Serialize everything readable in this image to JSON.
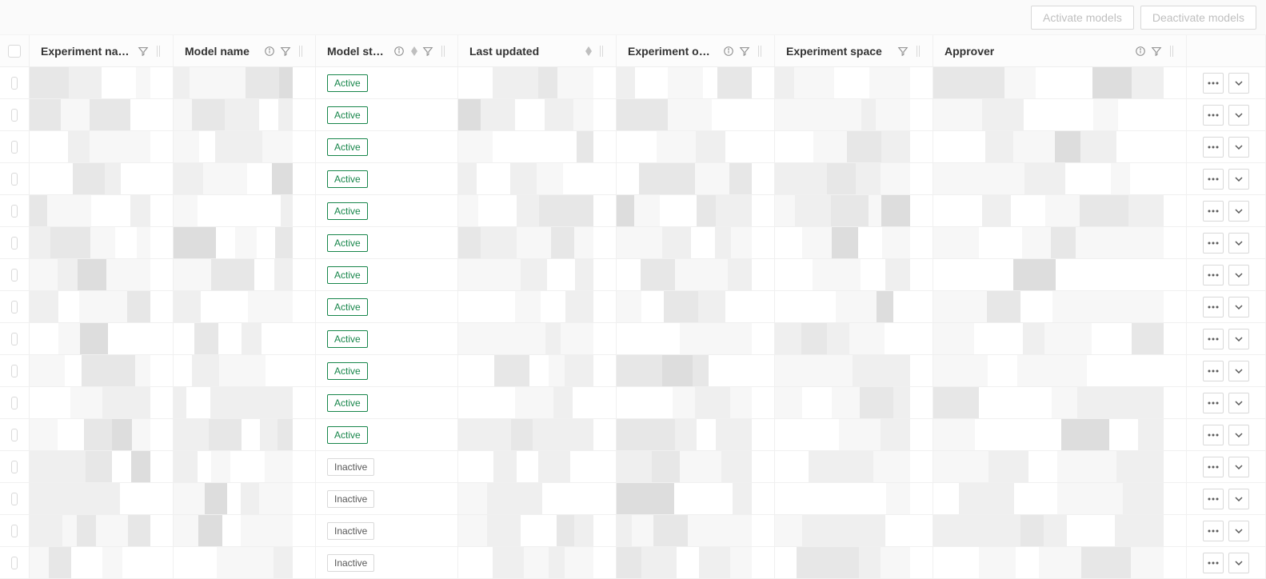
{
  "toolbar": {
    "activate_label": "Activate models",
    "deactivate_label": "Deactivate models"
  },
  "columns": {
    "experiment_name": "Experiment name",
    "model_name": "Model name",
    "model_status": "Model status",
    "last_updated": "Last updated",
    "experiment_owner": "Experiment owner",
    "experiment_space": "Experiment space",
    "approver": "Approver"
  },
  "status": {
    "active": "Active",
    "inactive": "Inactive"
  },
  "rows": [
    {
      "status": "active"
    },
    {
      "status": "active"
    },
    {
      "status": "active"
    },
    {
      "status": "active"
    },
    {
      "status": "active"
    },
    {
      "status": "active"
    },
    {
      "status": "active"
    },
    {
      "status": "active"
    },
    {
      "status": "active"
    },
    {
      "status": "active"
    },
    {
      "status": "active"
    },
    {
      "status": "active"
    },
    {
      "status": "inactive"
    },
    {
      "status": "inactive"
    },
    {
      "status": "inactive"
    },
    {
      "status": "inactive"
    }
  ]
}
